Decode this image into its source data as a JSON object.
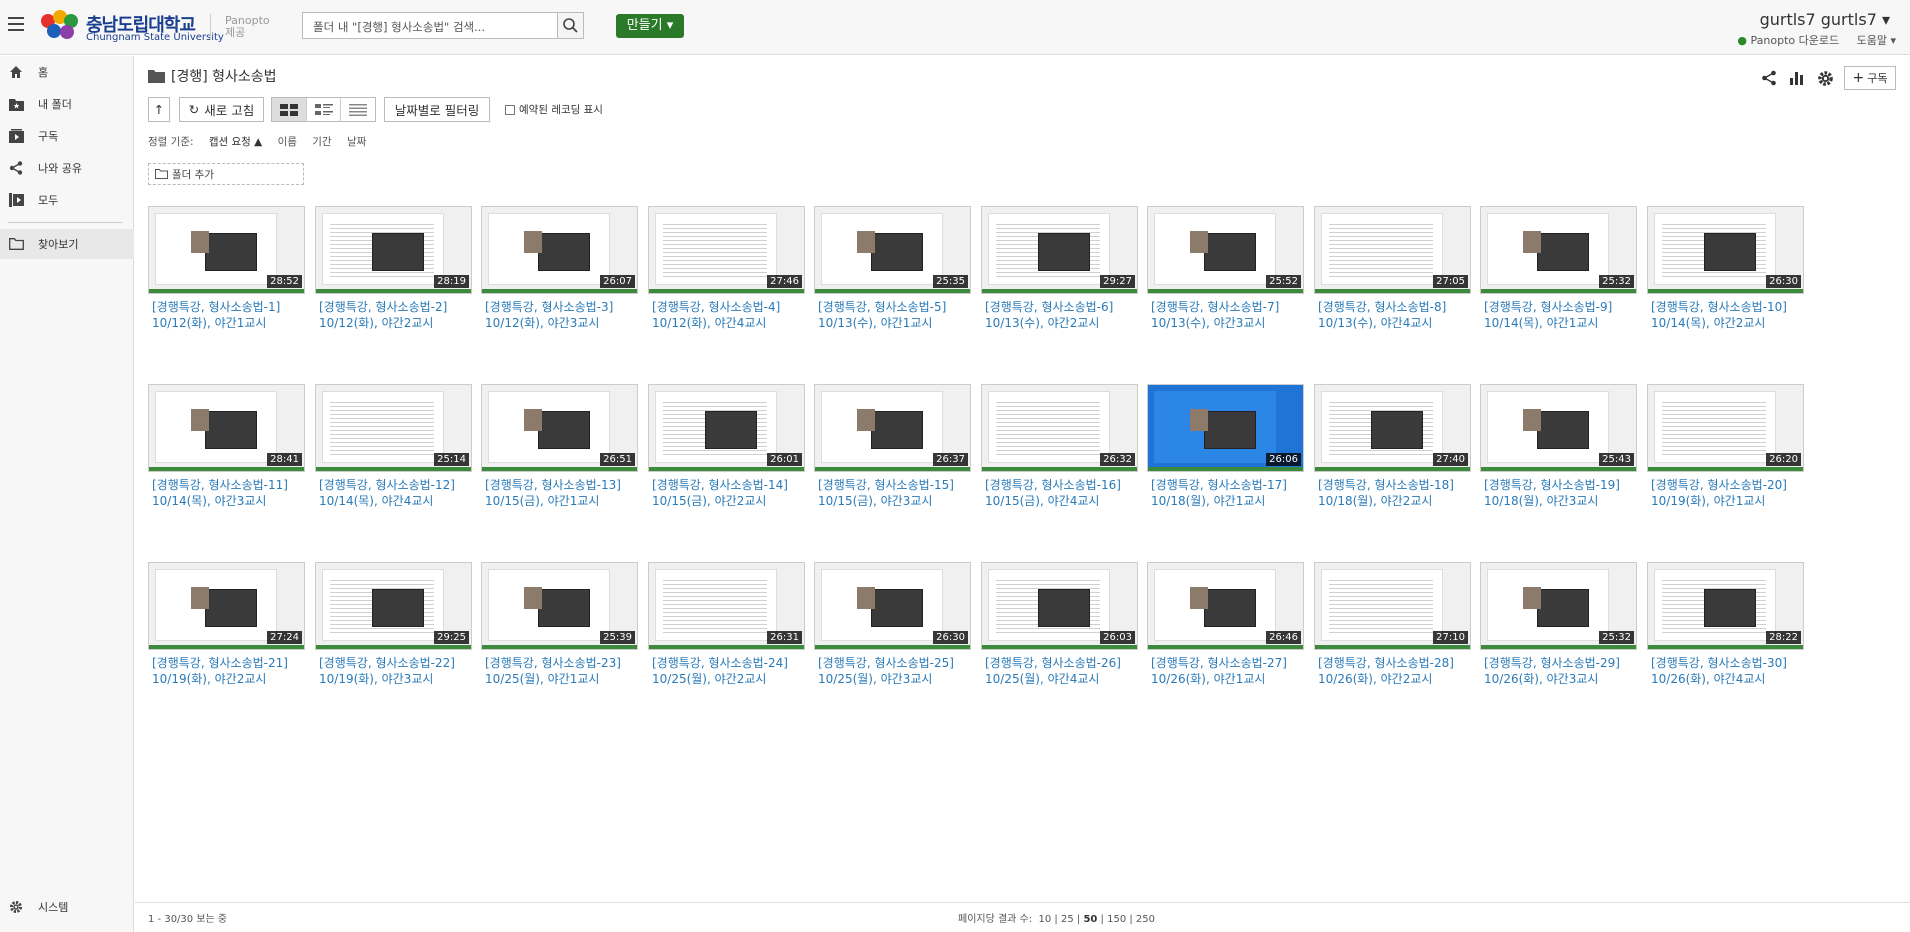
{
  "header": {
    "logo_text": "충남도립대학교",
    "logo_sub": "Chungnam State University",
    "panopto_label": "Panopto 제공",
    "search_placeholder": "폴더 내 \"[경행] 형사소송법\" 검색...",
    "create_label": "만들기",
    "user_name": "gurtls7 gurtls7",
    "download_label": "Panopto 다운로드",
    "help_label": "도움말"
  },
  "sidebar": {
    "items": [
      {
        "label": "홈",
        "icon": "home-icon"
      },
      {
        "label": "내 폴더",
        "icon": "my-folder-icon"
      },
      {
        "label": "구독",
        "icon": "subscription-icon"
      },
      {
        "label": "나와 공유",
        "icon": "share-icon"
      },
      {
        "label": "모두",
        "icon": "all-icon"
      },
      {
        "label": "찾아보기",
        "icon": "browse-folder-icon"
      }
    ],
    "system_label": "시스템"
  },
  "main": {
    "folder_title": "[경행] 형사소송법",
    "refresh_label": "새로 고침",
    "date_filter_label": "날짜별로 필터링",
    "schedule_label": "예약된 레코딩 표시",
    "sort_prefix": "정렬 기준:",
    "sort_options": [
      "캡션 요청 ▲",
      "이름",
      "기간",
      "날짜"
    ],
    "add_folder_label": "폴더 추가",
    "subscribe_label": "구독"
  },
  "sessions": [
    {
      "title": "[경행특강, 형사소송법-1]",
      "sub": "10/12(화), 야간1교시",
      "duration": "28:52"
    },
    {
      "title": "[경행특강, 형사소송법-2]",
      "sub": "10/12(화), 야간2교시",
      "duration": "28:19"
    },
    {
      "title": "[경행특강, 형사소송법-3]",
      "sub": "10/12(화), 야간3교시",
      "duration": "26:07"
    },
    {
      "title": "[경행특강, 형사소송법-4]",
      "sub": "10/12(화), 야간4교시",
      "duration": "27:46"
    },
    {
      "title": "[경행특강, 형사소송법-5]",
      "sub": "10/13(수), 야간1교시",
      "duration": "25:35"
    },
    {
      "title": "[경행특강, 형사소송법-6]",
      "sub": "10/13(수), 야간2교시",
      "duration": "29:27"
    },
    {
      "title": "[경행특강, 형사소송법-7]",
      "sub": "10/13(수), 야간3교시",
      "duration": "25:52"
    },
    {
      "title": "[경행특강, 형사소송법-8]",
      "sub": "10/13(수), 야간4교시",
      "duration": "27:05"
    },
    {
      "title": "[경행특강, 형사소송법-9]",
      "sub": "10/14(목), 야간1교시",
      "duration": "25:32"
    },
    {
      "title": "[경행특강, 형사소송법-10]",
      "sub": "10/14(목), 야간2교시",
      "duration": "26:30"
    },
    {
      "title": "[경행특강, 형사소송법-11]",
      "sub": "10/14(목), 야간3교시",
      "duration": "28:41"
    },
    {
      "title": "[경행특강, 형사소송법-12]",
      "sub": "10/14(목), 야간4교시",
      "duration": "25:14"
    },
    {
      "title": "[경행특강, 형사소송법-13]",
      "sub": "10/15(금), 야간1교시",
      "duration": "26:51"
    },
    {
      "title": "[경행특강, 형사소송법-14]",
      "sub": "10/15(금), 야간2교시",
      "duration": "26:01"
    },
    {
      "title": "[경행특강, 형사소송법-15]",
      "sub": "10/15(금), 야간3교시",
      "duration": "26:37"
    },
    {
      "title": "[경행특강, 형사소송법-16]",
      "sub": "10/15(금), 야간4교시",
      "duration": "26:32"
    },
    {
      "title": "[경행특강, 형사소송법-17]",
      "sub": "10/18(월), 야간1교시",
      "duration": "26:06"
    },
    {
      "title": "[경행특강, 형사소송법-18]",
      "sub": "10/18(월), 야간2교시",
      "duration": "27:40"
    },
    {
      "title": "[경행특강, 형사소송법-19]",
      "sub": "10/18(월), 야간3교시",
      "duration": "25:43"
    },
    {
      "title": "[경행특강, 형사소송법-20]",
      "sub": "10/19(화), 야간1교시",
      "duration": "26:20"
    },
    {
      "title": "[경행특강, 형사소송법-21]",
      "sub": "10/19(화), 야간2교시",
      "duration": "27:24"
    },
    {
      "title": "[경행특강, 형사소송법-22]",
      "sub": "10/19(화), 야간3교시",
      "duration": "29:25"
    },
    {
      "title": "[경행특강, 형사소송법-23]",
      "sub": "10/25(월), 야간1교시",
      "duration": "25:39"
    },
    {
      "title": "[경행특강, 형사소송법-24]",
      "sub": "10/25(월), 야간2교시",
      "duration": "26:31"
    },
    {
      "title": "[경행특강, 형사소송법-25]",
      "sub": "10/25(월), 야간3교시",
      "duration": "26:30"
    },
    {
      "title": "[경행특강, 형사소송법-26]",
      "sub": "10/25(월), 야간4교시",
      "duration": "26:03"
    },
    {
      "title": "[경행특강, 형사소송법-27]",
      "sub": "10/26(화), 야간1교시",
      "duration": "26:46"
    },
    {
      "title": "[경행특강, 형사소송법-28]",
      "sub": "10/26(화), 야간2교시",
      "duration": "27:10"
    },
    {
      "title": "[경행특강, 형사소송법-29]",
      "sub": "10/26(화), 야간3교시",
      "duration": "25:32"
    },
    {
      "title": "[경행특강, 형사소송법-30]",
      "sub": "10/26(화), 야간4교시",
      "duration": "28:22"
    }
  ],
  "footer": {
    "count_text": "1 - 30/30 보는 중",
    "per_page_label": "페이지당 결과 수:",
    "per_page_options": [
      "10",
      "25",
      "50",
      "150",
      "250"
    ],
    "per_page_selected": "50"
  },
  "colors": {
    "accent_green": "#2a7a2a",
    "link_blue": "#2a7ab8",
    "progress_green": "#3c8a3c",
    "logo_blue": "#1b3f8f"
  }
}
